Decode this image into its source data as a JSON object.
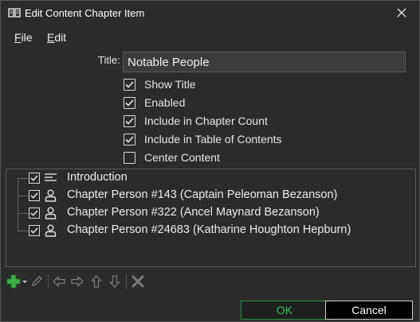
{
  "window": {
    "title": "Edit Content Chapter Item"
  },
  "menu": [
    {
      "label": "File",
      "mnemonic": "F",
      "rest": "ile"
    },
    {
      "label": "Edit",
      "mnemonic": "E",
      "rest": "dit"
    }
  ],
  "form": {
    "title_label": "Title:",
    "title_value": "Notable People",
    "options": [
      {
        "label": "Show Title",
        "checked": true
      },
      {
        "label": "Enabled",
        "checked": true
      },
      {
        "label": "Include in Chapter Count",
        "checked": true
      },
      {
        "label": "Include in Table of Contents",
        "checked": true
      },
      {
        "label": "Center Content",
        "checked": false
      }
    ]
  },
  "tree": {
    "items": [
      {
        "label": "Introduction",
        "icon": "text-lines-icon",
        "checked": true
      },
      {
        "label": "Chapter Person #143 (Captain Peleoman Bezanson)",
        "icon": "person-icon",
        "checked": true
      },
      {
        "label": "Chapter Person #322 (Ancel Maynard Bezanson)",
        "icon": "person-icon",
        "checked": true
      },
      {
        "label": "Chapter Person #24683 (Katharine Houghton Hepburn)",
        "icon": "person-icon",
        "checked": true
      }
    ]
  },
  "toolbar": [
    "add-icon",
    "edit-pencil-icon",
    "move-left-icon",
    "move-right-icon",
    "move-up-icon",
    "move-down-icon",
    "delete-icon"
  ],
  "buttons": {
    "ok": "OK",
    "cancel": "Cancel"
  },
  "colors": {
    "background": "#2b2b2b",
    "ok_accent": "#36c25a",
    "add_green": "#3cb043"
  }
}
